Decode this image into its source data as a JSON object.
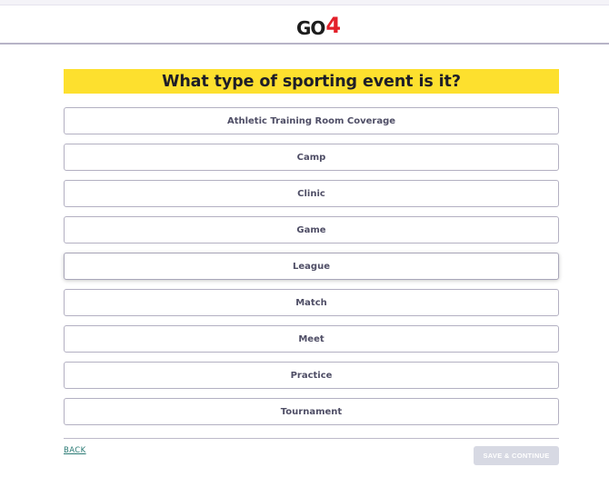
{
  "header": {
    "logo_main": "GO",
    "logo_accent": "4"
  },
  "question": {
    "title": "What type of sporting event is it?"
  },
  "options": [
    {
      "label": "Athletic Training Room Coverage"
    },
    {
      "label": "Camp"
    },
    {
      "label": "Clinic"
    },
    {
      "label": "Game"
    },
    {
      "label": "League"
    },
    {
      "label": "Match"
    },
    {
      "label": "Meet"
    },
    {
      "label": "Practice"
    },
    {
      "label": "Tournament"
    }
  ],
  "footer": {
    "back_label": "BACK",
    "save_label": "SAVE & CONTINUE",
    "save_disabled": true
  },
  "colors": {
    "question_highlight": "#fde02e",
    "logo_accent": "#e3202a",
    "back_link": "#2a7a74",
    "save_disabled_bg": "#d7d9e3"
  }
}
